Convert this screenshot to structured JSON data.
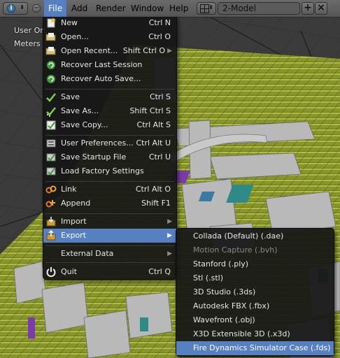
{
  "header": {
    "editor_icon": "info-icon",
    "menus": [
      "File",
      "Add",
      "Render",
      "Window",
      "Help"
    ],
    "active_menu": "File",
    "screen_layout": "2-Model",
    "add_icon": "plus-icon",
    "remove_icon": "x-icon"
  },
  "viewport": {
    "view_label": "User Ort",
    "units_label": "Meters"
  },
  "file_menu": {
    "items": [
      {
        "label": "New",
        "shortcut": "Ctrl N",
        "icon": "new-file-icon"
      },
      {
        "label": "Open...",
        "shortcut": "Ctrl O",
        "icon": "open-folder-icon"
      },
      {
        "label": "Open Recent...",
        "shortcut": "Shift Ctrl O",
        "icon": "open-recent-icon"
      },
      {
        "label": "Recover Last Session",
        "shortcut": "",
        "icon": "recover-icon"
      },
      {
        "label": "Recover Auto Save...",
        "shortcut": "",
        "icon": "recover-auto-icon"
      },
      {
        "label": "Save",
        "shortcut": "Ctrl S",
        "icon": "checkmark-icon"
      },
      {
        "label": "Save As...",
        "shortcut": "Shift Ctrl S",
        "icon": "save-as-icon"
      },
      {
        "label": "Save Copy...",
        "shortcut": "Ctrl Alt S",
        "icon": "save-copy-icon"
      },
      {
        "label": "User Preferences...",
        "shortcut": "Ctrl Alt U",
        "icon": "preferences-icon"
      },
      {
        "label": "Save Startup File",
        "shortcut": "Ctrl U",
        "icon": "save-startup-icon"
      },
      {
        "label": "Load Factory Settings",
        "shortcut": "",
        "icon": "factory-settings-icon"
      },
      {
        "label": "Link",
        "shortcut": "Ctrl Alt O",
        "icon": "link-icon"
      },
      {
        "label": "Append",
        "shortcut": "Shift F1",
        "icon": "append-icon"
      },
      {
        "label": "Import",
        "shortcut": "",
        "icon": "import-icon"
      },
      {
        "label": "Export",
        "shortcut": "",
        "icon": "export-icon"
      },
      {
        "label": "External Data",
        "shortcut": "",
        "icon": "external-data-icon"
      },
      {
        "label": "Quit",
        "shortcut": "Ctrl Q",
        "icon": "power-icon"
      }
    ]
  },
  "export_menu": {
    "items": [
      {
        "label": "Collada (Default) (.dae)",
        "enabled": true
      },
      {
        "label": "Motion Capture (.bvh)",
        "enabled": false
      },
      {
        "label": "Stanford (.ply)",
        "enabled": true
      },
      {
        "label": "Stl (.stl)",
        "enabled": true
      },
      {
        "label": "3D Studio (.3ds)",
        "enabled": true
      },
      {
        "label": "Autodesk FBX (.fbx)",
        "enabled": true
      },
      {
        "label": "Wavefront (.obj)",
        "enabled": true
      },
      {
        "label": "X3D Extensible 3D (.x3d)",
        "enabled": true
      },
      {
        "label": "Fire Dynamics Simulator Case (.fds)",
        "enabled": true
      }
    ],
    "highlighted": "Fire Dynamics Simulator Case (.fds)"
  },
  "colors": {
    "menu_highlight": "#5680c2",
    "menu_background": "#161616",
    "header_background": "#606060"
  }
}
